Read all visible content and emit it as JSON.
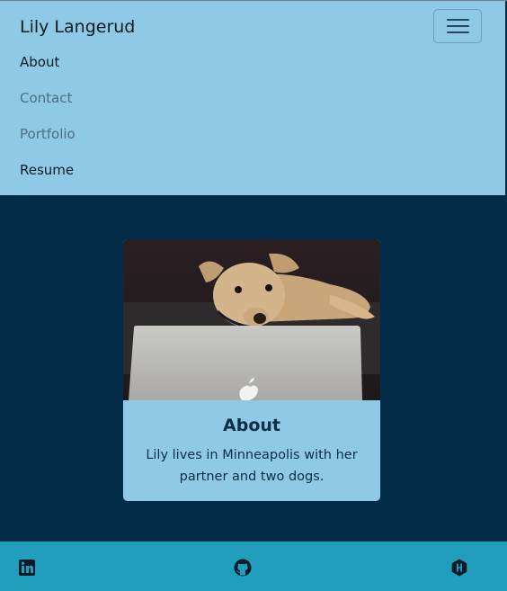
{
  "navbar": {
    "brand": "Lily Langerud",
    "toggle_icon": "hamburger-menu-icon",
    "links": [
      {
        "label": "About",
        "state": "active"
      },
      {
        "label": "Contact",
        "state": "inactive"
      },
      {
        "label": "Portfolio",
        "state": "inactive"
      },
      {
        "label": "Resume",
        "state": "active"
      }
    ]
  },
  "card": {
    "image_alt": "dog resting behind a laptop",
    "title": "About",
    "text": "Lily lives in Minneapolis with her partner and two dogs."
  },
  "footer": {
    "icons": [
      "linkedin-icon",
      "github-icon",
      "hackerrank-icon"
    ]
  },
  "colors": {
    "navbar_bg": "#8ecae6",
    "page_bg": "#022c47",
    "card_bg": "#8ecae6",
    "footer_bg": "#219ebc",
    "text_dark": "#0a2e45"
  }
}
